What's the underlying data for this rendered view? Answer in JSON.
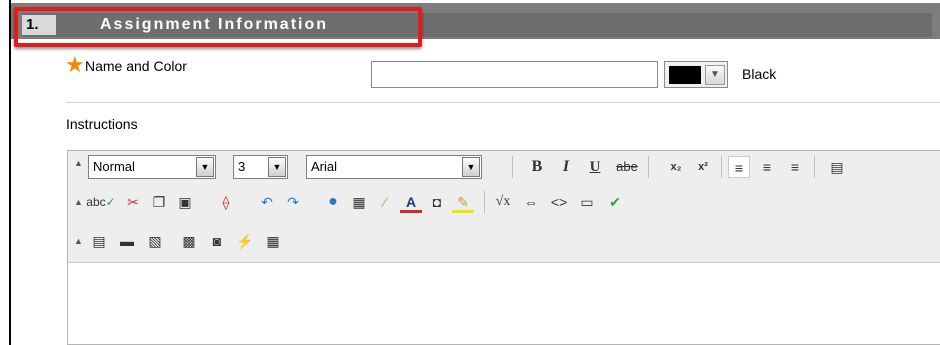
{
  "section": {
    "number": "1.",
    "title": "Assignment Information"
  },
  "name_field": {
    "label": "Name and Color",
    "value": "",
    "required_symbol": "★"
  },
  "color": {
    "name": "Black",
    "swatch": "#000000"
  },
  "instructions": {
    "label": "Instructions"
  },
  "editor": {
    "format_select": "Normal",
    "size_select": "3",
    "font_select": "Arial",
    "row1_buttons": [
      "B",
      "I",
      "U",
      "abe",
      "x₂",
      "x²"
    ],
    "spell_label": "abc"
  },
  "colors": {
    "highlight": "#e31b1b",
    "header_bg": "#7d7d7d",
    "required": "#f08a00"
  }
}
